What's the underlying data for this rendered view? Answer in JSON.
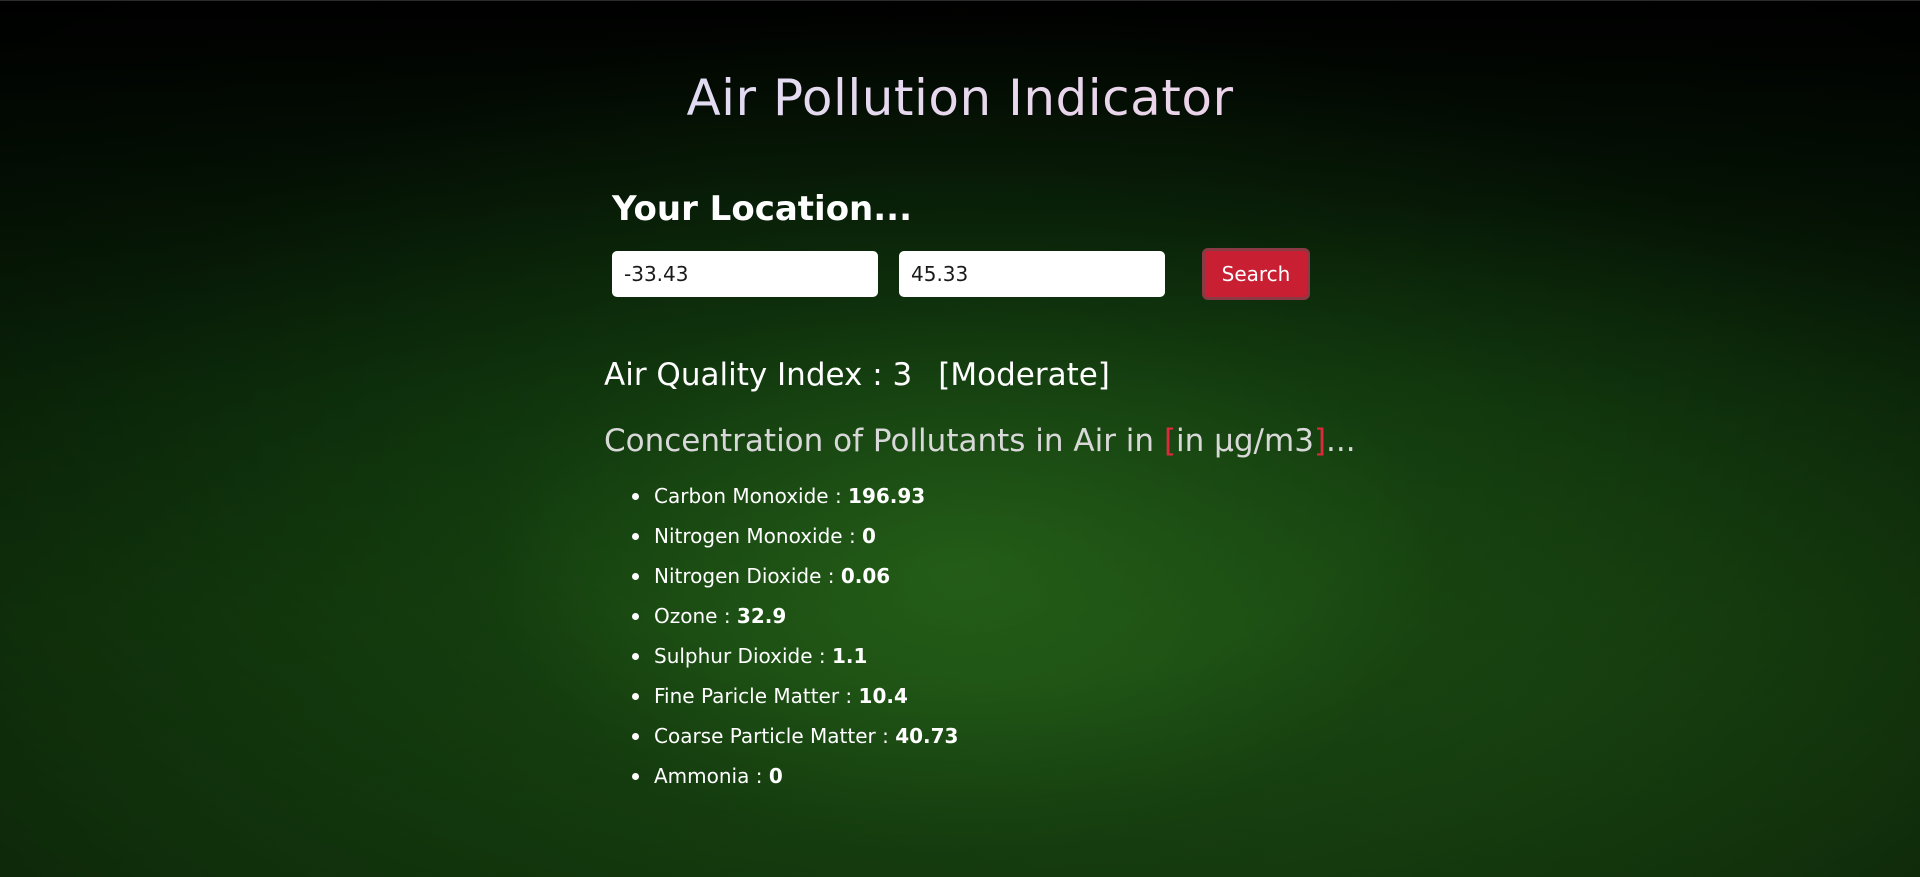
{
  "page": {
    "title": "Air Pollution Indicator"
  },
  "location": {
    "heading": "Your Location...",
    "latitude_value": "-33.43",
    "longitude_value": "45.33",
    "search_label": "Search"
  },
  "aqi": {
    "label": "Air Quality Index : 3",
    "category": "[Moderate]"
  },
  "concentration": {
    "heading_prefix": "Concentration of Pollutants in Air in ",
    "bracket_open": "[",
    "unit": "in µg/m3",
    "bracket_close": "]",
    "heading_suffix": "...",
    "items": [
      {
        "label": "Carbon Monoxide : ",
        "value": "196.93"
      },
      {
        "label": "Nitrogen Monoxide : ",
        "value": "0"
      },
      {
        "label": "Nitrogen Dioxide : ",
        "value": "0.06"
      },
      {
        "label": "Ozone : ",
        "value": "32.9"
      },
      {
        "label": "Sulphur Dioxide : ",
        "value": "1.1"
      },
      {
        "label": "Fine Paricle Matter : ",
        "value": "10.4"
      },
      {
        "label": "Coarse Particle Matter : ",
        "value": "40.73"
      },
      {
        "label": "Ammonia : ",
        "value": "0"
      }
    ]
  },
  "colors": {
    "search_button_bg": "#c81f33",
    "bracket_accent": "#e0283c",
    "background_green": "#16440f"
  }
}
